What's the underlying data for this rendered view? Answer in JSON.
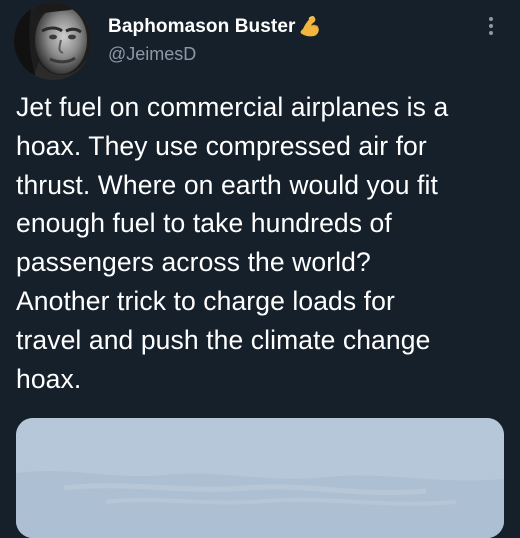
{
  "author": {
    "display_name": "Baphomason Buster",
    "handle": "@JeimesD",
    "badge_icon": "flexed-biceps-icon"
  },
  "tweet": {
    "text": "Jet fuel on commercial airplanes is a\nhoax. They use compressed air for\nthrust. Where on earth would you fit\nenough fuel to take hundreds of\npassengers across the world?\nAnother trick to charge loads for\ntravel and push the climate change\nhoax."
  },
  "colors": {
    "background": "#15202b",
    "primary_text": "#ffffff",
    "secondary_text": "#8b98a5",
    "media_sky": "#b7c8d9"
  },
  "icons": {
    "more": "more-vertical-icon",
    "avatar": "profile-photo"
  }
}
